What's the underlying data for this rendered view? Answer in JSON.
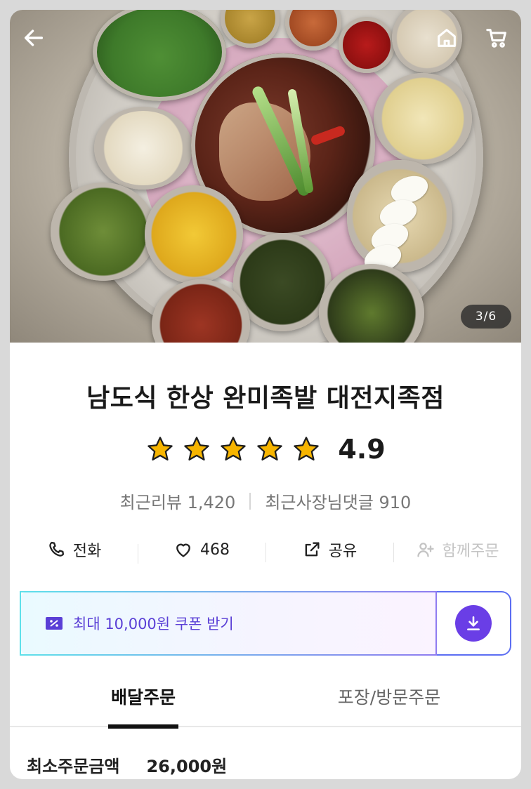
{
  "hero": {
    "page_indicator": "3/6",
    "icons": {
      "back": "arrow-left-icon",
      "home": "home-icon",
      "cart": "cart-icon"
    }
  },
  "store": {
    "name": "남도식 한상 완미족발 대전지족점",
    "rating": 4.9,
    "rating_label": "4.9",
    "stars_filled": 5,
    "recent_reviews": "최근리뷰 1,420",
    "recent_owner_replies": "최근사장님댓글 910"
  },
  "actions": [
    {
      "label": "전화",
      "icon": "phone-icon"
    },
    {
      "label": "468",
      "icon": "heart-icon"
    },
    {
      "label": "공유",
      "icon": "share-icon"
    },
    {
      "label": "함께주문",
      "icon": "add-person-icon"
    }
  ],
  "coupon": {
    "text": "최대 10,000원 쿠폰 받기",
    "icon": "coupon-icon",
    "download_icon": "download-icon"
  },
  "tabs": [
    {
      "label": "배달주문",
      "active": true
    },
    {
      "label": "포장/방문주문",
      "active": false
    }
  ],
  "min_order": {
    "label": "최소주문금액",
    "value": "26,000원"
  },
  "colors": {
    "accent": "#6a3ee6",
    "star": "#f7b500"
  }
}
